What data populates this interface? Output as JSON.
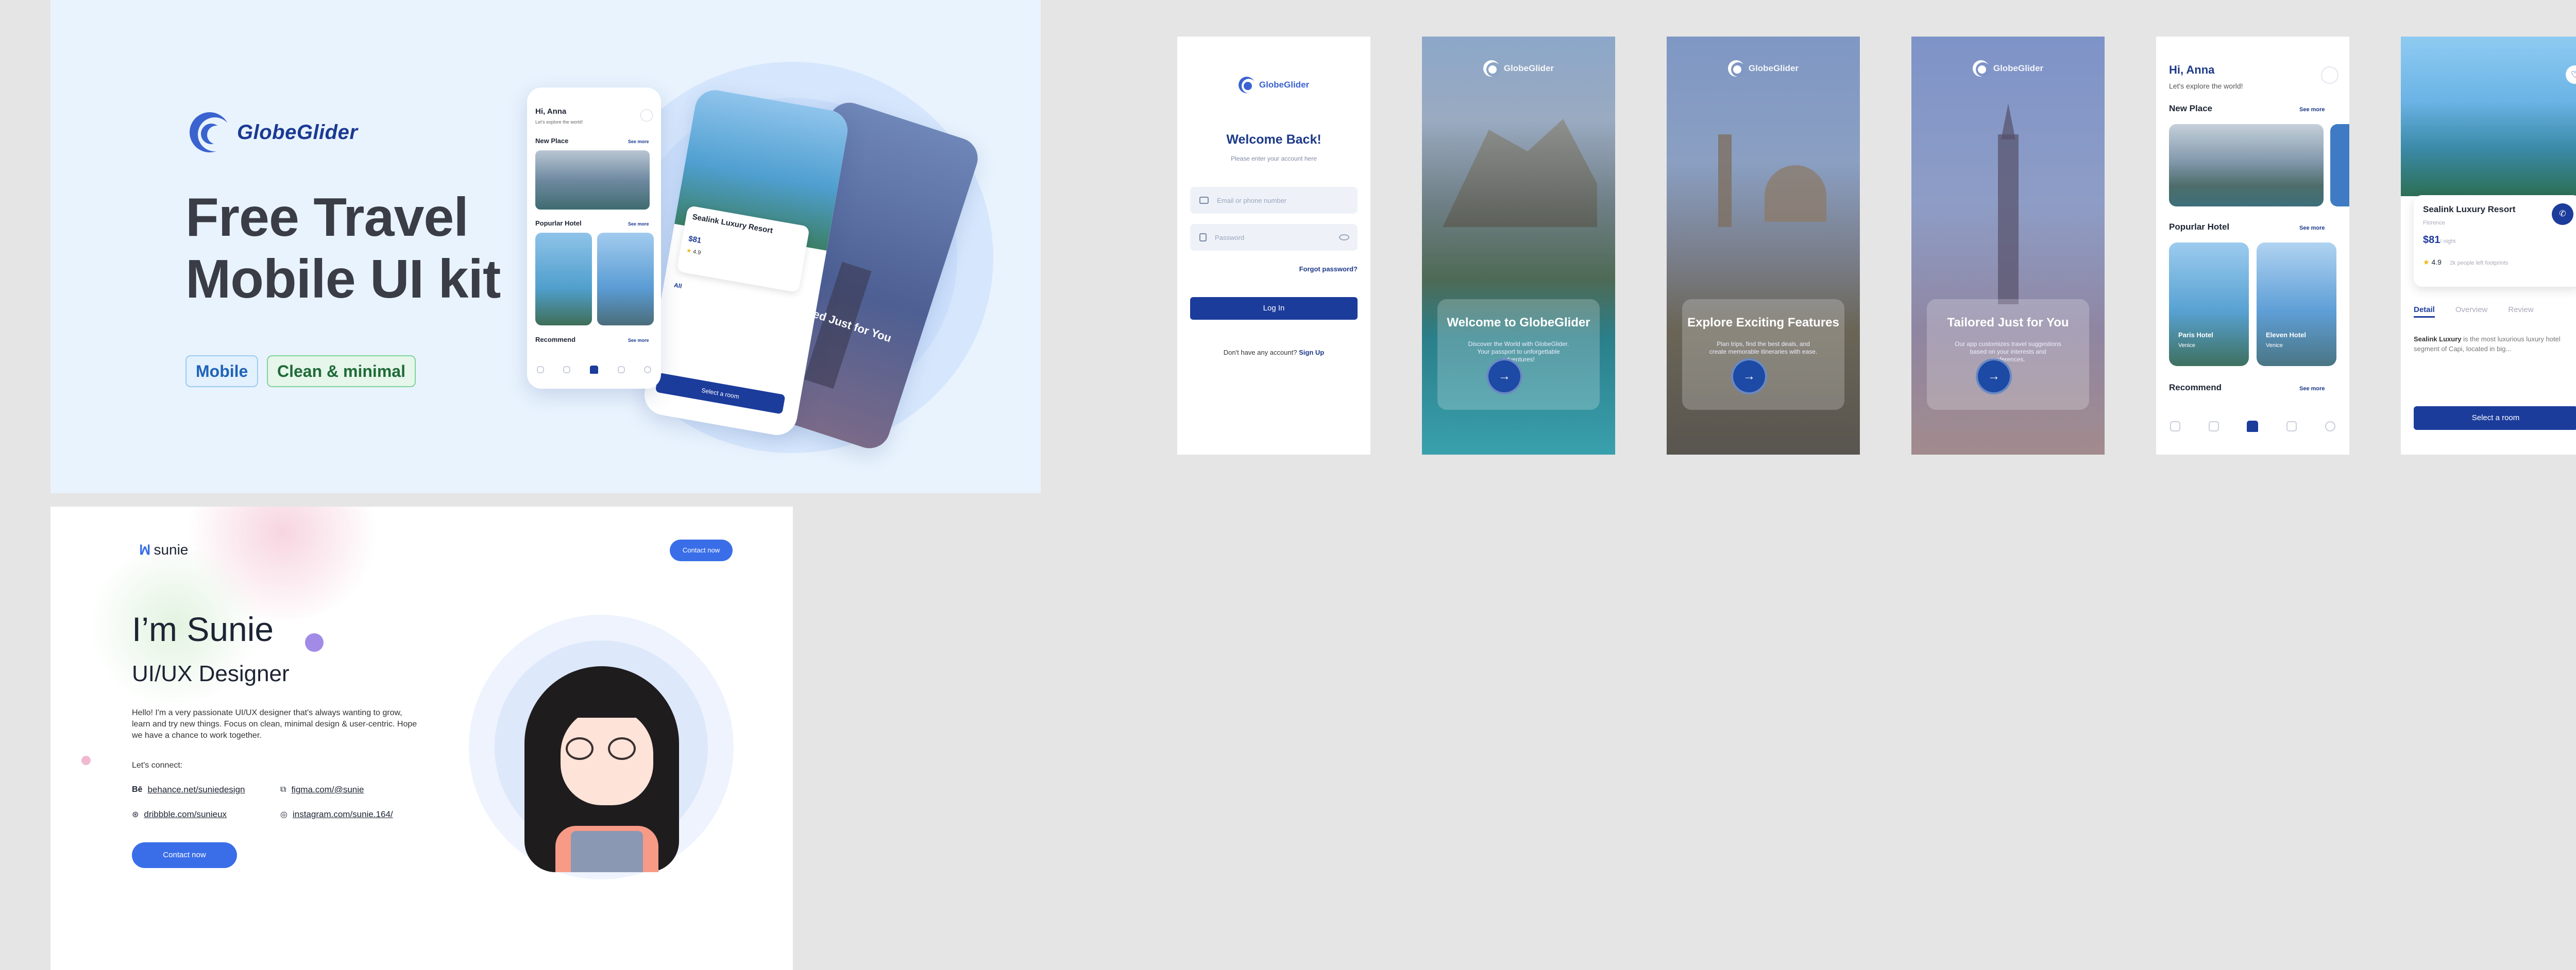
{
  "cover": {
    "brand": "GlobeGlider",
    "headline_line1": "Free Travel",
    "headline_line2": "Mobile UI kit",
    "tags": [
      "Mobile",
      "Clean & minimal"
    ],
    "mock": {
      "greeting": "Hi, Anna",
      "sub": "Let's explore the world!",
      "new_place": "New Place",
      "popular_hotel": "Popurlar Hotel",
      "recommend": "Recommend",
      "see_more": "See more",
      "hotel_name": "Sealink Luxury Resort",
      "price": "$81",
      "rating": "4.9",
      "detail": "All",
      "select_room": "Select a room",
      "tailored": "Tailored Just for You"
    }
  },
  "login": {
    "brand": "GlobeGlider",
    "title": "Welcome Back!",
    "subtitle": "Please enter your account here",
    "email_placeholder": "Email or phone number",
    "password_placeholder": "Password",
    "forgot": "Forgot password?",
    "login_button": "Log In",
    "no_account": "Don't have any account?",
    "signup": "Sign Up"
  },
  "onboarding": [
    {
      "brand": "GlobeGlider",
      "title": "Welcome to GlobeGlider",
      "desc": "Discover the World with GlobeGlider. Your passport to unforgettable adventures!"
    },
    {
      "brand": "GlobeGlider",
      "title": "Explore Exciting Features",
      "desc": "Plan trips, find the best deals, and create memorable itineraries with ease."
    },
    {
      "brand": "GlobeGlider",
      "title": "Tailored Just for You",
      "desc": "Our app customizes travel suggestions based on your interests and preferences."
    }
  ],
  "home": {
    "greeting": "Hi, Anna",
    "sub": "Let's explore the world!",
    "new_place": "New Place",
    "see_more": "See more",
    "popular_hotel": "Popurlar Hotel",
    "hotels": [
      {
        "name": "Paris Hotel",
        "loc": "Venice"
      },
      {
        "name": "Eleven Hotel",
        "loc": "Venice"
      }
    ],
    "recommend": "Recommend"
  },
  "detail": {
    "name": "Sealink Luxury Resort",
    "loc": "Florence",
    "price": "$81",
    "per": "/ night",
    "rating": "4.9",
    "reviews": "2k people left footprints",
    "tabs": [
      "Detail",
      "Overview",
      "Review"
    ],
    "desc_bold": "Sealink Luxury",
    "desc": " is the most luxurious luxury hotel segment of Capi, located in big...",
    "button": "Select a room"
  },
  "sunie": {
    "brand": "sunie",
    "contact_top": "Contact now",
    "hello": "I’m Sunie",
    "role": "UI/UX Designer",
    "bio": "Hello! I'm a very passionate UI/UX designer that's always wanting to grow, learn and try new things. Focus on clean, minimal design & user-centric. Hope we have a chance to work together.",
    "connect": "Let's connect:",
    "links": [
      "behance.net/suniedesign",
      "figma.com/@sunie",
      "dribbble.com/sunieux",
      "instagram.com/sunie.164/"
    ],
    "contact_btn": "Contact now"
  },
  "colors": {
    "primary": "#1c3c9c",
    "accent": "#3a6ee8",
    "bg": "#e5e5e5"
  }
}
